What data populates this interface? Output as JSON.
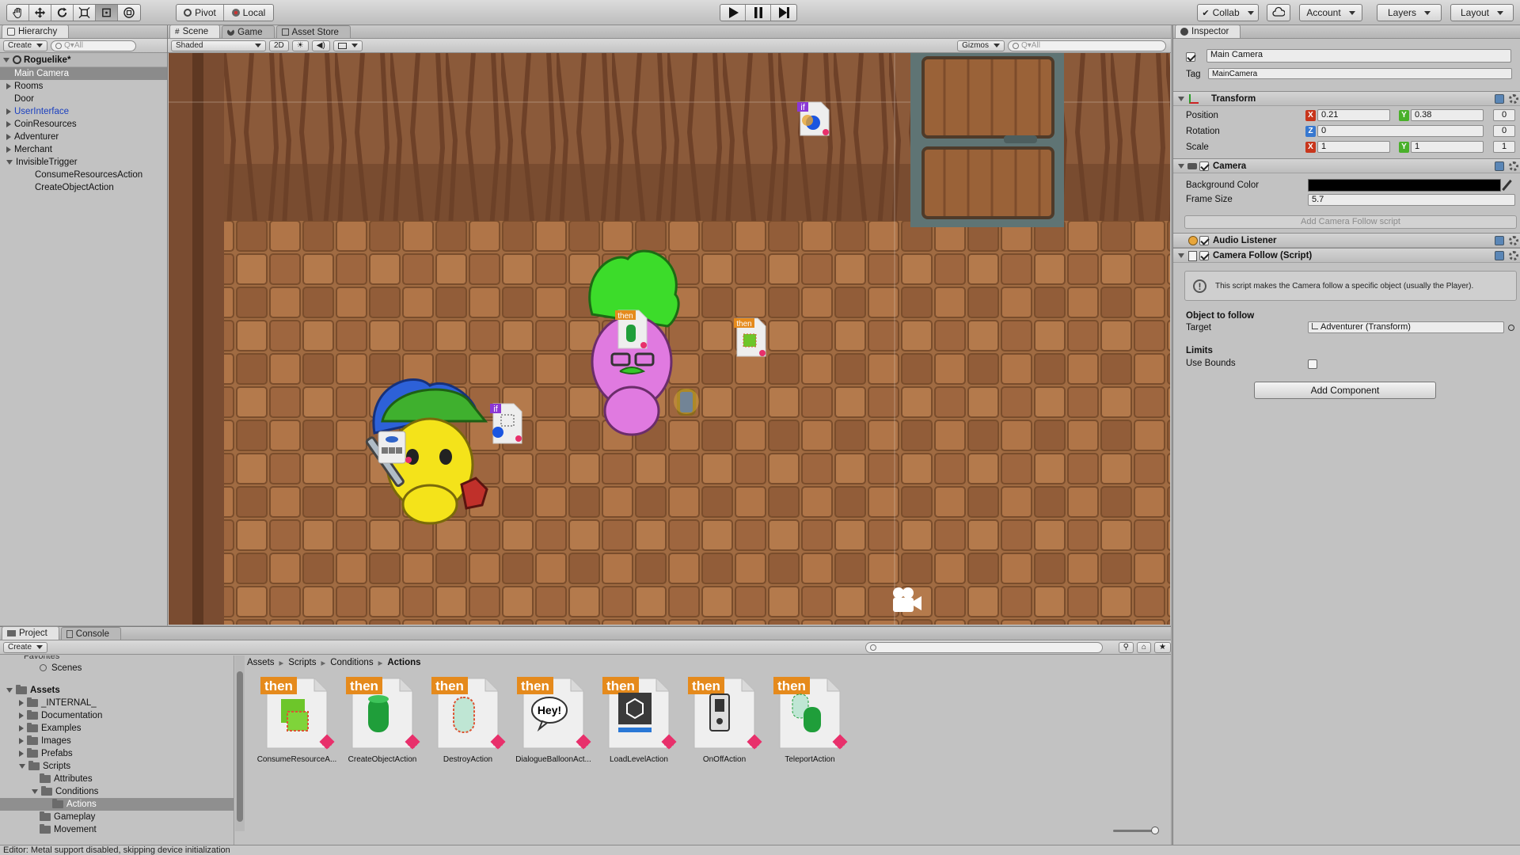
{
  "toolbar": {
    "pivot": "Pivot",
    "local": "Local",
    "collab": "Collab",
    "account": "Account",
    "layers": "Layers",
    "layout": "Layout"
  },
  "hierarchy": {
    "tab": "Hierarchy",
    "create": "Create",
    "search_placeholder": "Q▾All",
    "scene_name": "Roguelike*",
    "items": [
      {
        "label": "Main Camera",
        "indent": 1,
        "arrow": "none",
        "selected": true
      },
      {
        "label": "Rooms",
        "indent": 1,
        "arrow": "right"
      },
      {
        "label": "Door",
        "indent": 1,
        "arrow": "none"
      },
      {
        "label": "UserInterface",
        "indent": 1,
        "arrow": "right",
        "color": "#1a3fbf"
      },
      {
        "label": "CoinResources",
        "indent": 1,
        "arrow": "right"
      },
      {
        "label": "Adventurer",
        "indent": 1,
        "arrow": "right"
      },
      {
        "label": "Merchant",
        "indent": 1,
        "arrow": "right"
      },
      {
        "label": "InvisibleTrigger",
        "indent": 1,
        "arrow": "down"
      },
      {
        "label": "ConsumeResourcesAction",
        "indent": 2,
        "arrow": "none"
      },
      {
        "label": "CreateObjectAction",
        "indent": 2,
        "arrow": "none"
      }
    ]
  },
  "scene": {
    "tabs": {
      "scene": "Scene",
      "game": "Game",
      "store": "Asset Store"
    },
    "shaded": "Shaded",
    "two_d": "2D",
    "gizmos": "Gizmos",
    "search_placeholder": "Q▾All",
    "badge_if": "if",
    "badge_then": "then"
  },
  "inspector": {
    "tab": "Inspector",
    "object_name": "Main Camera",
    "tag_label": "Tag",
    "tag_value": "MainCamera",
    "transform": {
      "title": "Transform",
      "position_label": "Position",
      "rotation_label": "Rotation",
      "scale_label": "Scale",
      "pos_x": "0.21",
      "pos_y": "0.38",
      "pos_z": "0",
      "rot_z": "0",
      "rot_extra": "0",
      "scale_x": "1",
      "scale_y": "1",
      "scale_z": "1",
      "x": "X",
      "y": "Y",
      "z": "Z"
    },
    "camera": {
      "title": "Camera",
      "bg_label": "Background Color",
      "frame_label": "Frame Size",
      "frame_value": "5.7",
      "add_follow": "Add Camera Follow script",
      "bg_color": "#000000"
    },
    "audio": {
      "title": "Audio Listener"
    },
    "follow": {
      "title": "Camera Follow (Script)",
      "help_text": "This script makes the Camera follow a specific object (usually the Player).",
      "object_header": "Object to follow",
      "target_label": "Target",
      "target_value": "Adventurer (Transform)",
      "limits_header": "Limits",
      "bounds_label": "Use Bounds"
    },
    "add_component": "Add Component"
  },
  "project": {
    "tabs": {
      "project": "Project",
      "console": "Console"
    },
    "create": "Create",
    "favorites_cut": "Favorites",
    "tree": [
      {
        "label": "Scenes",
        "indent": 2,
        "arrow": "none",
        "icon": "search"
      },
      {
        "label": "Assets",
        "indent": 0,
        "arrow": "down",
        "icon": "folder",
        "bold": true
      },
      {
        "label": "_INTERNAL_",
        "indent": 1,
        "arrow": "right",
        "icon": "folder"
      },
      {
        "label": "Documentation",
        "indent": 1,
        "arrow": "right",
        "icon": "folder"
      },
      {
        "label": "Examples",
        "indent": 1,
        "arrow": "right",
        "icon": "folder"
      },
      {
        "label": "Images",
        "indent": 1,
        "arrow": "right",
        "icon": "folder"
      },
      {
        "label": "Prefabs",
        "indent": 1,
        "arrow": "right",
        "icon": "folder"
      },
      {
        "label": "Scripts",
        "indent": 1,
        "arrow": "down",
        "icon": "folder"
      },
      {
        "label": "Attributes",
        "indent": 2,
        "arrow": "none",
        "icon": "folder"
      },
      {
        "label": "Conditions",
        "indent": 2,
        "arrow": "down",
        "icon": "folder"
      },
      {
        "label": "Actions",
        "indent": 3,
        "arrow": "none",
        "icon": "folder",
        "selected": true
      },
      {
        "label": "Gameplay",
        "indent": 2,
        "arrow": "none",
        "icon": "folder"
      },
      {
        "label": "Movement",
        "indent": 2,
        "arrow": "none",
        "icon": "folder"
      }
    ],
    "breadcrumb": [
      "Assets",
      "Scripts",
      "Conditions",
      "Actions"
    ],
    "assets": [
      {
        "label": "ConsumeResourceA...",
        "glyph": "cube"
      },
      {
        "label": "CreateObjectAction",
        "glyph": "cylinder"
      },
      {
        "label": "DestroyAction",
        "glyph": "ghost"
      },
      {
        "label": "DialogueBalloonAct...",
        "glyph": "balloon",
        "text": "Hey!"
      },
      {
        "label": "LoadLevelAction",
        "glyph": "unity"
      },
      {
        "label": "OnOffAction",
        "glyph": "switch"
      },
      {
        "label": "TeleportAction",
        "glyph": "teleport"
      }
    ]
  },
  "status": {
    "message": "Editor: Metal support disabled, skipping device initialization"
  }
}
